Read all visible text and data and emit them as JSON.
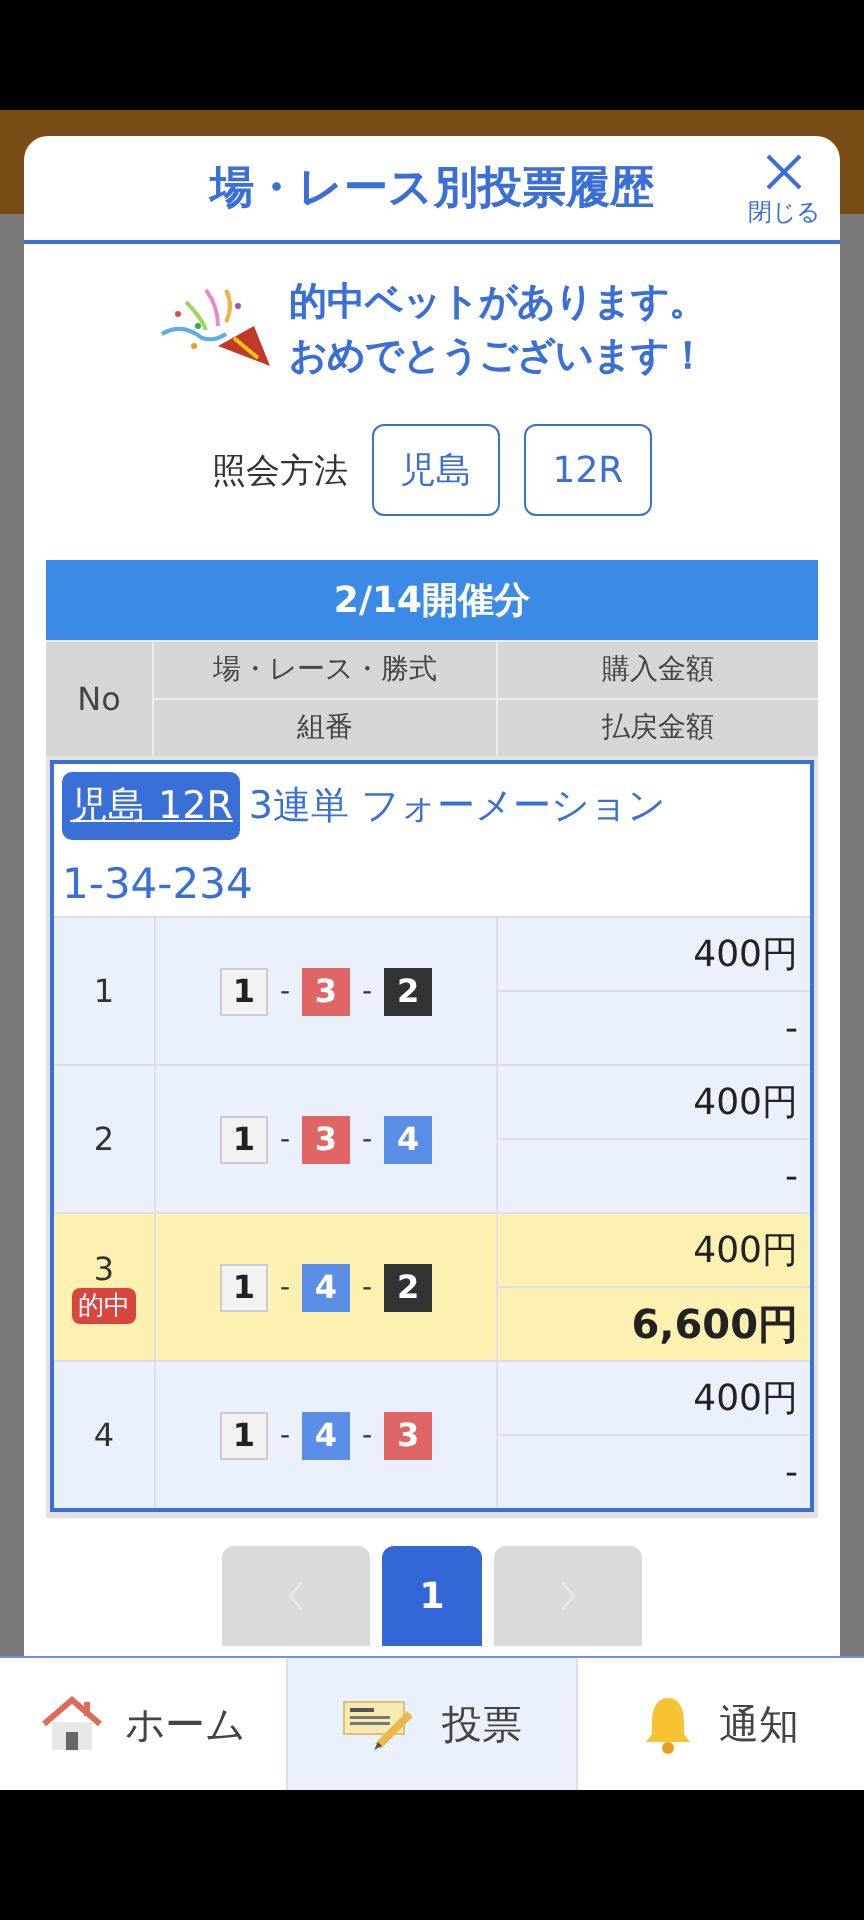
{
  "modal": {
    "title": "場・レース別投票履歴",
    "close_label": "閉じる"
  },
  "congrats": {
    "lines": [
      "的中ベットがあります。",
      "おめでとうございます！"
    ]
  },
  "query": {
    "label": "照会方法",
    "buttons": [
      "児島",
      "12R"
    ]
  },
  "table": {
    "date_header": "2/14開催分",
    "columns": {
      "no": "No",
      "race": "場・レース・勝式",
      "combo": "組番",
      "purchase": "購入金額",
      "payout": "払戻金額"
    },
    "bet": {
      "race_tag": "児島 12R",
      "bet_type": "3連単 フォーメーション",
      "selection": "1-34-234",
      "rows": [
        {
          "no": "1",
          "hit": false,
          "boats": [
            {
              "num": "1",
              "color": "#f2f2f2"
            },
            {
              "dash": "-",
              "num": "3",
              "color": "#e06666"
            },
            {
              "dash": "-",
              "num": "2",
              "color": "#333333"
            }
          ],
          "purchase": "400円",
          "payout": "-"
        },
        {
          "no": "2",
          "hit": false,
          "boats": [
            {
              "num": "1",
              "color": "#f2f2f2"
            },
            {
              "dash": "-",
              "num": "3",
              "color": "#e06666"
            },
            {
              "dash": "-",
              "num": "4",
              "color": "#5b8ee6"
            }
          ],
          "purchase": "400円",
          "payout": "-"
        },
        {
          "no": "3",
          "hit": true,
          "hit_label": "的中",
          "boats": [
            {
              "num": "1",
              "color": "#f2f2f2"
            },
            {
              "dash": "-",
              "num": "4",
              "color": "#5b8ee6"
            },
            {
              "dash": "-",
              "num": "2",
              "color": "#333333"
            }
          ],
          "purchase": "400円",
          "payout": "6,600円"
        },
        {
          "no": "4",
          "hit": false,
          "boats": [
            {
              "num": "1",
              "color": "#f2f2f2"
            },
            {
              "dash": "-",
              "num": "4",
              "color": "#5b8ee6"
            },
            {
              "dash": "-",
              "num": "3",
              "color": "#e06666"
            }
          ],
          "purchase": "400円",
          "payout": "-"
        }
      ]
    }
  },
  "pagination": {
    "pages": [
      {
        "label": "1",
        "selected": true
      }
    ]
  },
  "nav": [
    {
      "kind": "home",
      "label": "ホーム",
      "selected": false
    },
    {
      "kind": "ticket",
      "label": "投票",
      "selected": true
    },
    {
      "kind": "bell",
      "label": "通知",
      "selected": false
    }
  ]
}
